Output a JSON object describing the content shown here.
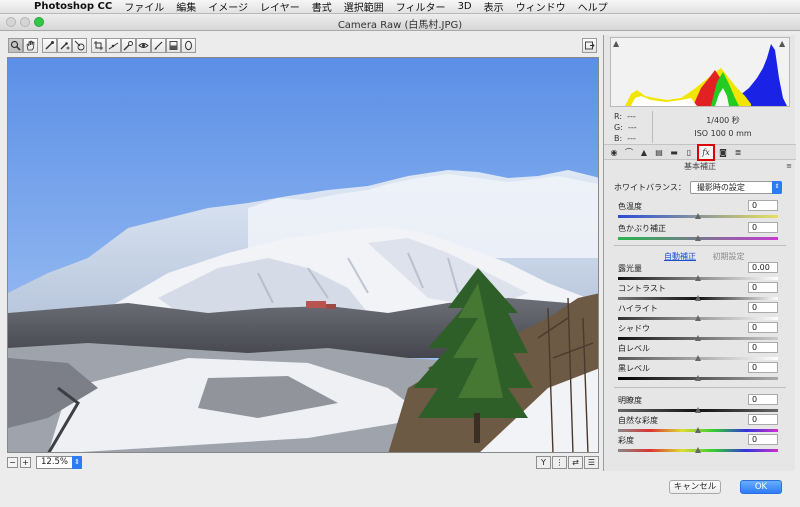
{
  "menubar": {
    "app_name": "Photoshop CC",
    "items": [
      "ファイル",
      "編集",
      "イメージ",
      "レイヤー",
      "書式",
      "選択範囲",
      "フィルター",
      "3D",
      "表示",
      "ウィンドウ",
      "ヘルプ"
    ]
  },
  "window": {
    "title": "Camera Raw (白馬村.JPG)"
  },
  "toolbar": {
    "tools": [
      "zoom-icon",
      "hand-icon",
      "white-balance-icon",
      "color-sampler-icon",
      "targeted-adjust-icon",
      "crop-icon",
      "straighten-icon",
      "spot-removal-icon",
      "red-eye-icon",
      "adjustment-brush-icon",
      "graduated-filter-icon",
      "radial-filter-icon"
    ],
    "active_tool": "zoom-icon"
  },
  "preview": {
    "zoom": "12.5%"
  },
  "histogram": {
    "r_label": "R:",
    "g_label": "G:",
    "b_label": "B:",
    "r_value": "---",
    "g_value": "---",
    "b_value": "---",
    "shutter": "1/400 秒",
    "iso_focal": "ISO 100    0 mm"
  },
  "tabs": {
    "selected_label": "fx",
    "section_title": "基本補正"
  },
  "basic": {
    "white_balance_label": "ホワイトバランス：",
    "white_balance_value": "撮影時の設定",
    "auto_label": "自動補正",
    "default_label": "初期設定",
    "sliders": [
      {
        "label": "色温度",
        "value": "0"
      },
      {
        "label": "色かぶり補正",
        "value": "0"
      },
      {
        "label": "露光量",
        "value": "0.00"
      },
      {
        "label": "コントラスト",
        "value": "0"
      },
      {
        "label": "ハイライト",
        "value": "0"
      },
      {
        "label": "シャドウ",
        "value": "0"
      },
      {
        "label": "白レベル",
        "value": "0"
      },
      {
        "label": "黒レベル",
        "value": "0"
      },
      {
        "label": "明瞭度",
        "value": "0"
      },
      {
        "label": "自然な彩度",
        "value": "0"
      },
      {
        "label": "彩度",
        "value": "0"
      }
    ]
  },
  "footer": {
    "cancel_label": "キャンセル",
    "ok_label": "OK"
  },
  "colors": {
    "accent": "#2d7cf6",
    "highlight_box": "#e00000"
  }
}
